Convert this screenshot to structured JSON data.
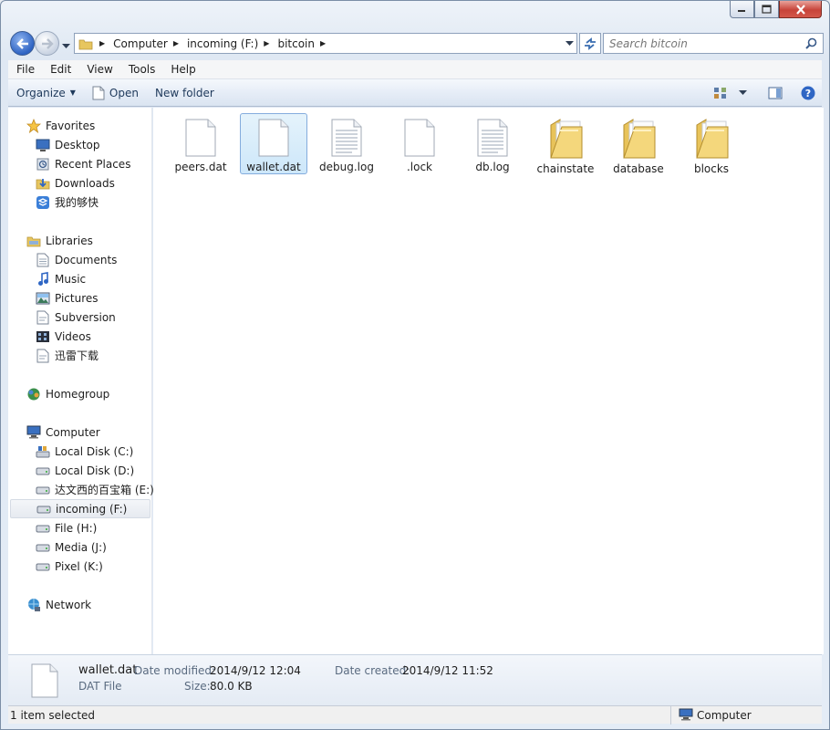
{
  "window": {
    "minimize_icon": "minimize-icon",
    "maximize_icon": "maximize-icon",
    "close_icon": "close-icon"
  },
  "nav": {
    "breadcrumbs": [
      "Computer",
      "incoming (F:)",
      "bitcoin"
    ],
    "search_placeholder": "Search bitcoin"
  },
  "menu": [
    "File",
    "Edit",
    "View",
    "Tools",
    "Help"
  ],
  "toolbar": {
    "organize": "Organize",
    "open": "Open",
    "new_folder": "New folder"
  },
  "sidebar": {
    "favorites": {
      "label": "Favorites",
      "items": [
        "Desktop",
        "Recent Places",
        "Downloads",
        "我的够快"
      ]
    },
    "libraries": {
      "label": "Libraries",
      "items": [
        "Documents",
        "Music",
        "Pictures",
        "Subversion",
        "Videos",
        "迅雷下载"
      ]
    },
    "homegroup": {
      "label": "Homegroup"
    },
    "computer": {
      "label": "Computer",
      "items": [
        "Local Disk (C:)",
        "Local Disk (D:)",
        "达文西的百宝箱 (E:)",
        "incoming (F:)",
        "File (H:)",
        "Media (J:)",
        "Pixel (K:)"
      ],
      "selected": "incoming (F:)"
    },
    "network": {
      "label": "Network"
    }
  },
  "files": [
    {
      "name": "peers.dat",
      "type": "file"
    },
    {
      "name": "wallet.dat",
      "type": "file",
      "selected": true
    },
    {
      "name": "debug.log",
      "type": "text"
    },
    {
      "name": ".lock",
      "type": "file"
    },
    {
      "name": "db.log",
      "type": "text"
    },
    {
      "name": "chainstate",
      "type": "folder"
    },
    {
      "name": "database",
      "type": "folder"
    },
    {
      "name": "blocks",
      "type": "folder"
    }
  ],
  "details": {
    "name": "wallet.dat",
    "type": "DAT File",
    "date_modified_label": "Date modified:",
    "date_modified": "2014/9/12 12:04",
    "size_label": "Size:",
    "size": "80.0 KB",
    "date_created_label": "Date created:",
    "date_created": "2014/9/12 11:52"
  },
  "status": {
    "left": "1 item selected",
    "right": "Computer"
  }
}
